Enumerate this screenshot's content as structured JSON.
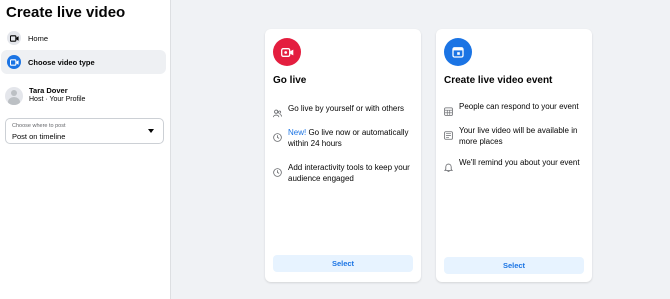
{
  "sidebar": {
    "title": "Create live video",
    "items": [
      {
        "label": "Home",
        "icon": "live-video-icon"
      },
      {
        "label": "Choose video type",
        "icon": "live-video-icon",
        "active": true
      }
    ],
    "profile": {
      "name": "Tara Dover",
      "role": "Host · Your Profile"
    },
    "post_location": {
      "label": "Choose where to post",
      "value": "Post on timeline"
    }
  },
  "cards": [
    {
      "title": "Go live",
      "icon": "live-camera-icon",
      "icon_color": "#e41e3f",
      "features": [
        {
          "icon": "people-icon",
          "text": "Go live by yourself or with others"
        },
        {
          "icon": "clock-icon",
          "new_tag": "New!",
          "text": " Go live now or automatically within 24 hours"
        },
        {
          "icon": "clock-icon",
          "text": "Add interactivity tools to keep your audience engaged"
        }
      ],
      "button": "Select"
    },
    {
      "title": "Create live video event",
      "icon": "calendar-icon",
      "icon_color": "#1b74e4",
      "features": [
        {
          "icon": "calendar-grid-icon",
          "text": "People can respond to your event"
        },
        {
          "icon": "news-feed-icon",
          "text": "Your live video will be available in more places"
        },
        {
          "icon": "bell-icon",
          "text": "We'll remind you about your event"
        }
      ],
      "button": "Select"
    }
  ],
  "colors": {
    "accent": "#1b74e4",
    "live_red": "#e41e3f",
    "page_bg": "#f0f2f5"
  }
}
